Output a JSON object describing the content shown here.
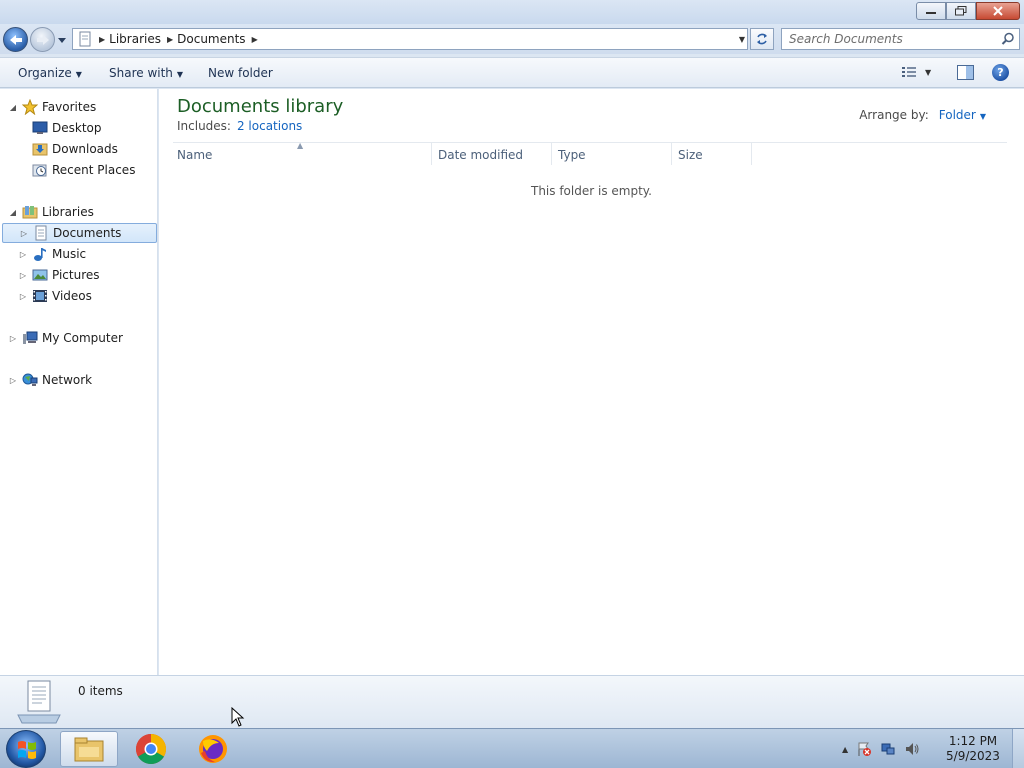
{
  "window": {
    "controls": [
      "minimize",
      "restore",
      "close"
    ]
  },
  "address": {
    "crumbs": [
      "Libraries",
      "Documents"
    ],
    "search_placeholder": "Search Documents"
  },
  "toolbar": {
    "organize": "Organize",
    "share_with": "Share with",
    "new_folder": "New folder"
  },
  "nav": {
    "favorites": "Favorites",
    "desktop": "Desktop",
    "downloads": "Downloads",
    "recent_places": "Recent Places",
    "libraries": "Libraries",
    "documents": "Documents",
    "music": "Music",
    "pictures": "Pictures",
    "videos": "Videos",
    "my_computer": "My Computer",
    "network": "Network"
  },
  "main": {
    "title": "Documents library",
    "includes_label": "Includes:",
    "includes_link": "2 locations",
    "arrange_label": "Arrange by:",
    "arrange_value": "Folder",
    "columns": [
      "Name",
      "Date modified",
      "Type",
      "Size"
    ],
    "empty_message": "This folder is empty."
  },
  "details": {
    "count": "0 items"
  },
  "taskbar": {
    "apps": [
      "windows-explorer",
      "google-chrome",
      "firefox"
    ],
    "time": "1:12 PM",
    "date": "5/9/2023"
  },
  "colors": {
    "title_green": "#1c5e25",
    "link_blue": "#1565c0",
    "selection_border": "#84acdd"
  }
}
